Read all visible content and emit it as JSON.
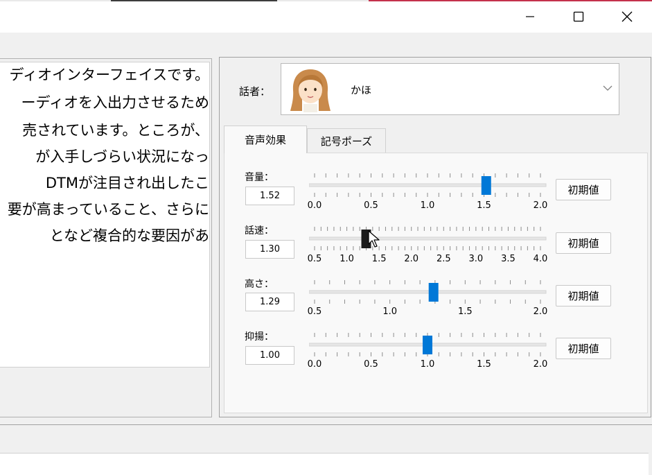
{
  "text": {
    "lines": [
      "ディオインターフェイスです。",
      "ーディオを入出力させるため",
      "売されています。ところが、",
      "が入手しづらい状況になっ",
      "DTMが注目され出したこ",
      "要が高まっていること、さらに",
      "となど複合的な要因があ"
    ]
  },
  "speaker": {
    "label": "話者：",
    "name": "かほ"
  },
  "tabs": [
    {
      "label": "音声効果",
      "active": true
    },
    {
      "label": "記号ポーズ",
      "active": false
    }
  ],
  "params": [
    {
      "label": "音量：",
      "value": "1.52",
      "min": 0.0,
      "max": 2.0,
      "ticks": [
        "0.0",
        "0.5",
        "1.0",
        "1.5",
        "2.0"
      ],
      "level": 1.52,
      "active": false,
      "reset": "初期値"
    },
    {
      "label": "話速：",
      "value": "1.30",
      "min": 0.5,
      "max": 4.0,
      "ticks": [
        "0.5",
        "1.0",
        "1.5",
        "2.0",
        "2.5",
        "3.0",
        "3.5",
        "4.0"
      ],
      "level": 1.3,
      "active": true,
      "reset": "初期値"
    },
    {
      "label": "高さ：",
      "value": "1.29",
      "min": 0.5,
      "max": 2.0,
      "ticks": [
        "0.5",
        "1.0",
        "1.5",
        "2.0"
      ],
      "level": 1.29,
      "active": false,
      "reset": "初期値"
    },
    {
      "label": "抑揚：",
      "value": "1.00",
      "min": 0.0,
      "max": 2.0,
      "ticks": [
        "0.0",
        "0.5",
        "1.0",
        "1.5",
        "2.0"
      ],
      "level": 1.0,
      "active": false,
      "reset": "初期値"
    }
  ],
  "icons": {
    "minimize": "minimize-icon",
    "maximize": "maximize-icon",
    "close": "close-icon",
    "dropdown": "chevron-down-icon",
    "cursor": "mouse-pointer-icon"
  },
  "colors": {
    "thumb": "#0078d7",
    "thumb_active": "#1a1a1a",
    "accent": "#c4314b"
  }
}
